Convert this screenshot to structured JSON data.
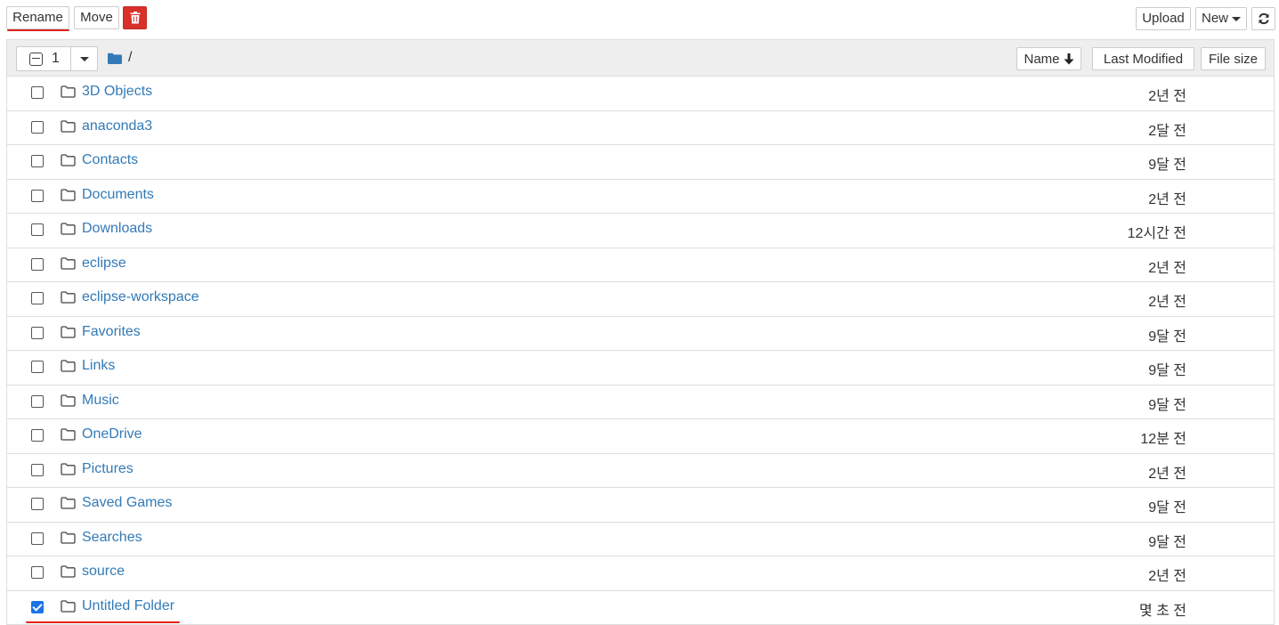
{
  "toolbar": {
    "rename_label": "Rename",
    "move_label": "Move",
    "delete_icon": "trash-icon",
    "upload_label": "Upload",
    "new_label": "New",
    "refresh_icon": "refresh-icon"
  },
  "list_header": {
    "selected_count": "1",
    "breadcrumb_path": "/",
    "sort_name_label": "Name",
    "sort_modified_label": "Last Modified",
    "sort_size_label": "File size"
  },
  "files": [
    {
      "name": "3D Objects",
      "modified": "2년 전",
      "checked": false
    },
    {
      "name": "anaconda3",
      "modified": "2달 전",
      "checked": false
    },
    {
      "name": "Contacts",
      "modified": "9달 전",
      "checked": false
    },
    {
      "name": "Documents",
      "modified": "2년 전",
      "checked": false
    },
    {
      "name": "Downloads",
      "modified": "12시간 전",
      "checked": false
    },
    {
      "name": "eclipse",
      "modified": "2년 전",
      "checked": false
    },
    {
      "name": "eclipse-workspace",
      "modified": "2년 전",
      "checked": false
    },
    {
      "name": "Favorites",
      "modified": "9달 전",
      "checked": false
    },
    {
      "name": "Links",
      "modified": "9달 전",
      "checked": false
    },
    {
      "name": "Music",
      "modified": "9달 전",
      "checked": false
    },
    {
      "name": "OneDrive",
      "modified": "12분 전",
      "checked": false
    },
    {
      "name": "Pictures",
      "modified": "2년 전",
      "checked": false
    },
    {
      "name": "Saved Games",
      "modified": "9달 전",
      "checked": false
    },
    {
      "name": "Searches",
      "modified": "9달 전",
      "checked": false
    },
    {
      "name": "source",
      "modified": "2년 전",
      "checked": false
    },
    {
      "name": "Untitled Folder",
      "modified": "몇 초 전",
      "checked": true
    }
  ],
  "colors": {
    "link": "#337ab7",
    "delete_button": "#d9302a",
    "checkbox_checked": "#1a73e8",
    "annotation_underline": "#e0241b"
  }
}
